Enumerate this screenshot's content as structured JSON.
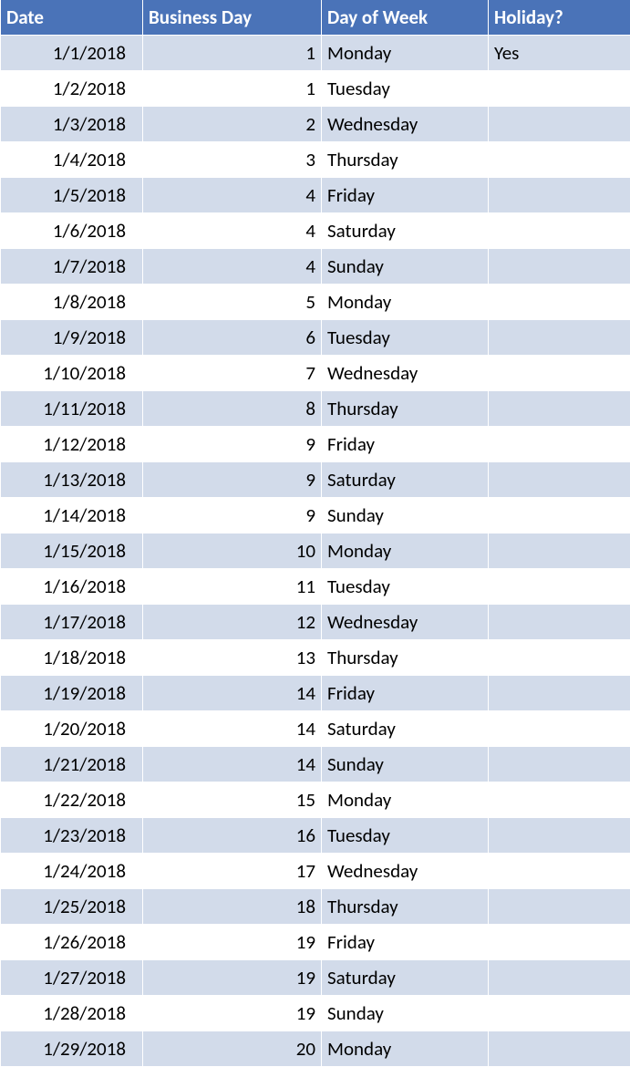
{
  "headers": {
    "date": "Date",
    "business_day": "Business Day",
    "day_of_week": "Day of Week",
    "holiday": "Holiday?"
  },
  "rows": [
    {
      "date": "1/1/2018",
      "business_day": "1",
      "day_of_week": "Monday",
      "holiday": "Yes"
    },
    {
      "date": "1/2/2018",
      "business_day": "1",
      "day_of_week": "Tuesday",
      "holiday": ""
    },
    {
      "date": "1/3/2018",
      "business_day": "2",
      "day_of_week": "Wednesday",
      "holiday": ""
    },
    {
      "date": "1/4/2018",
      "business_day": "3",
      "day_of_week": "Thursday",
      "holiday": ""
    },
    {
      "date": "1/5/2018",
      "business_day": "4",
      "day_of_week": "Friday",
      "holiday": ""
    },
    {
      "date": "1/6/2018",
      "business_day": "4",
      "day_of_week": "Saturday",
      "holiday": ""
    },
    {
      "date": "1/7/2018",
      "business_day": "4",
      "day_of_week": "Sunday",
      "holiday": ""
    },
    {
      "date": "1/8/2018",
      "business_day": "5",
      "day_of_week": "Monday",
      "holiday": ""
    },
    {
      "date": "1/9/2018",
      "business_day": "6",
      "day_of_week": "Tuesday",
      "holiday": ""
    },
    {
      "date": "1/10/2018",
      "business_day": "7",
      "day_of_week": "Wednesday",
      "holiday": ""
    },
    {
      "date": "1/11/2018",
      "business_day": "8",
      "day_of_week": "Thursday",
      "holiday": ""
    },
    {
      "date": "1/12/2018",
      "business_day": "9",
      "day_of_week": "Friday",
      "holiday": ""
    },
    {
      "date": "1/13/2018",
      "business_day": "9",
      "day_of_week": "Saturday",
      "holiday": ""
    },
    {
      "date": "1/14/2018",
      "business_day": "9",
      "day_of_week": "Sunday",
      "holiday": ""
    },
    {
      "date": "1/15/2018",
      "business_day": "10",
      "day_of_week": "Monday",
      "holiday": ""
    },
    {
      "date": "1/16/2018",
      "business_day": "11",
      "day_of_week": "Tuesday",
      "holiday": ""
    },
    {
      "date": "1/17/2018",
      "business_day": "12",
      "day_of_week": "Wednesday",
      "holiday": ""
    },
    {
      "date": "1/18/2018",
      "business_day": "13",
      "day_of_week": "Thursday",
      "holiday": ""
    },
    {
      "date": "1/19/2018",
      "business_day": "14",
      "day_of_week": "Friday",
      "holiday": ""
    },
    {
      "date": "1/20/2018",
      "business_day": "14",
      "day_of_week": "Saturday",
      "holiday": ""
    },
    {
      "date": "1/21/2018",
      "business_day": "14",
      "day_of_week": "Sunday",
      "holiday": ""
    },
    {
      "date": "1/22/2018",
      "business_day": "15",
      "day_of_week": "Monday",
      "holiday": ""
    },
    {
      "date": "1/23/2018",
      "business_day": "16",
      "day_of_week": "Tuesday",
      "holiday": ""
    },
    {
      "date": "1/24/2018",
      "business_day": "17",
      "day_of_week": "Wednesday",
      "holiday": ""
    },
    {
      "date": "1/25/2018",
      "business_day": "18",
      "day_of_week": "Thursday",
      "holiday": ""
    },
    {
      "date": "1/26/2018",
      "business_day": "19",
      "day_of_week": "Friday",
      "holiday": ""
    },
    {
      "date": "1/27/2018",
      "business_day": "19",
      "day_of_week": "Saturday",
      "holiday": ""
    },
    {
      "date": "1/28/2018",
      "business_day": "19",
      "day_of_week": "Sunday",
      "holiday": ""
    },
    {
      "date": "1/29/2018",
      "business_day": "20",
      "day_of_week": "Monday",
      "holiday": ""
    }
  ]
}
